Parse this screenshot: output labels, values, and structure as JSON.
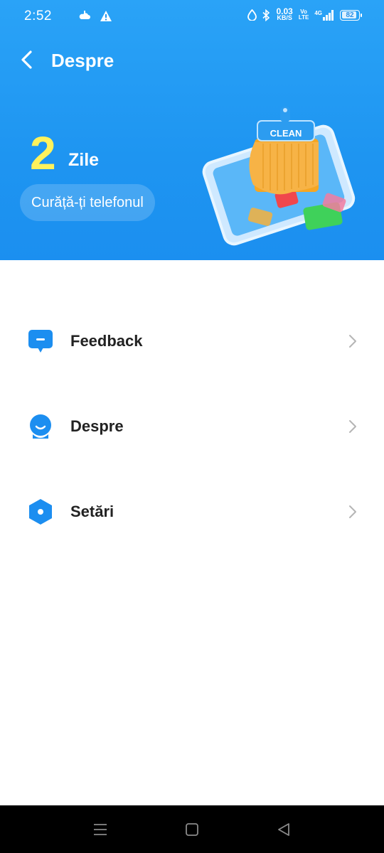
{
  "status_bar": {
    "time": "2:52",
    "net_speed_value": "0.03",
    "net_speed_unit": "KB/S",
    "volte_top": "Vo",
    "volte_bottom": "LTE",
    "network": "4G",
    "battery": "82",
    "icons": [
      "weather-icon",
      "warning-icon",
      "data-saver-icon",
      "bluetooth-icon",
      "signal-icon"
    ]
  },
  "header": {
    "title": "Despre",
    "days_count": "2",
    "days_unit": "Zile",
    "clean_button_label": "Curăță-ți telefonul",
    "illustration_label": "CLEAN",
    "colors": {
      "background": "#1e95f1",
      "days_number": "#fff25c"
    }
  },
  "menu": {
    "items": [
      {
        "label": "Feedback",
        "icon": "feedback-icon"
      },
      {
        "label": "Despre",
        "icon": "about-icon"
      },
      {
        "label": "Setări",
        "icon": "settings-icon"
      }
    ],
    "accent_color": "#1c8ef0"
  },
  "nav_bar": {
    "buttons": [
      "recents-button",
      "home-button",
      "back-button"
    ]
  }
}
